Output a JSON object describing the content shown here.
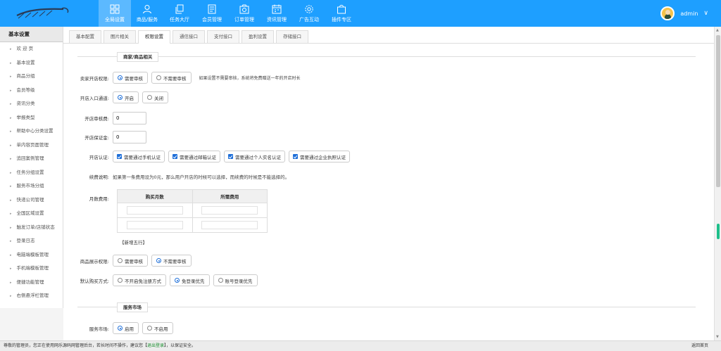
{
  "nav": {
    "items": [
      {
        "label": "全局设置",
        "icon": "grid-icon"
      },
      {
        "label": "商品/服务",
        "icon": "user-icon"
      },
      {
        "label": "任务大厅",
        "icon": "copy-icon"
      },
      {
        "label": "会员管理",
        "icon": "member-icon"
      },
      {
        "label": "订单管理",
        "icon": "camera-icon"
      },
      {
        "label": "资讯管理",
        "icon": "calendar-icon"
      },
      {
        "label": "广告互动",
        "icon": "gear-icon"
      },
      {
        "label": "插件专区",
        "icon": "bag-icon"
      }
    ],
    "active_index": 0,
    "user_name": "admin"
  },
  "sidebar": {
    "title": "基本设置",
    "items": [
      "欢 迎 页",
      "基本设置",
      "商品分组",
      "会员等级",
      "资讯分类",
      "举报类型",
      "帮助中心分类设置",
      "单内容页面管理",
      "追回案例管理",
      "任务分组设置",
      "服务市场分组",
      "快递公司管理",
      "全国区域设置",
      "触发订单/店铺状态",
      "登录日志",
      "电脑端模板管理",
      "手机端模板管理",
      "便捷功能管理",
      "右侧悬浮栏管理"
    ]
  },
  "tabs": [
    "基本配置",
    "图片相关",
    "权限设置",
    "通信接口",
    "支付接口",
    "盈利设置",
    "存储接口"
  ],
  "active_tab": 2,
  "form": {
    "section1": "商家/商品相关",
    "shop_open_perm": {
      "label": "卖家开店权限:",
      "opt1": "需要审核",
      "opt2": "不需要审核",
      "hint": "如果设置不需要审核，系统将免费赠送一年的开店时长"
    },
    "shop_entry": {
      "label": "开店入口通道:",
      "opt1": "开启",
      "opt2": "关闭"
    },
    "audit_fee": {
      "label": "开店审核费:",
      "value": "0"
    },
    "deposit": {
      "label": "开店保证金:",
      "value": "0"
    },
    "verify": {
      "label": "开店认证:",
      "opts": [
        "需要通过手机认证",
        "需要通过邮箱认证",
        "需要通过个人实名认证",
        "需要通过企业执照认证"
      ]
    },
    "renew_note": {
      "label": "续费说明:",
      "text": "如果第一条费用设为0元，那么用户开店的时候可以选择，而续费的时候是不能选择的。"
    },
    "monthly_fee": {
      "label": "月数费用:",
      "col1": "购买月数",
      "col2": "所需费用"
    },
    "add_row": "【新增五行】",
    "product_show": {
      "label": "商品展示权限:",
      "opt1": "需要审核",
      "opt2": "不需要审核"
    },
    "buy_mode": {
      "label": "默认购买方式:",
      "opt1": "不开启免注册方式",
      "opt2": "免登录优先",
      "opt3": "账号登录优先"
    },
    "section2": "服务市场",
    "service_market": {
      "label": "服务市场:",
      "opt1": "启用",
      "opt2": "不启用"
    }
  },
  "footer": {
    "text_before": "尊敬的管理员，您正在使用网乐源码网管理后台，若长时间不操作，建议您【",
    "logout": "退出登录",
    "text_after": "】，以保证安全。",
    "right": "返回首页"
  }
}
